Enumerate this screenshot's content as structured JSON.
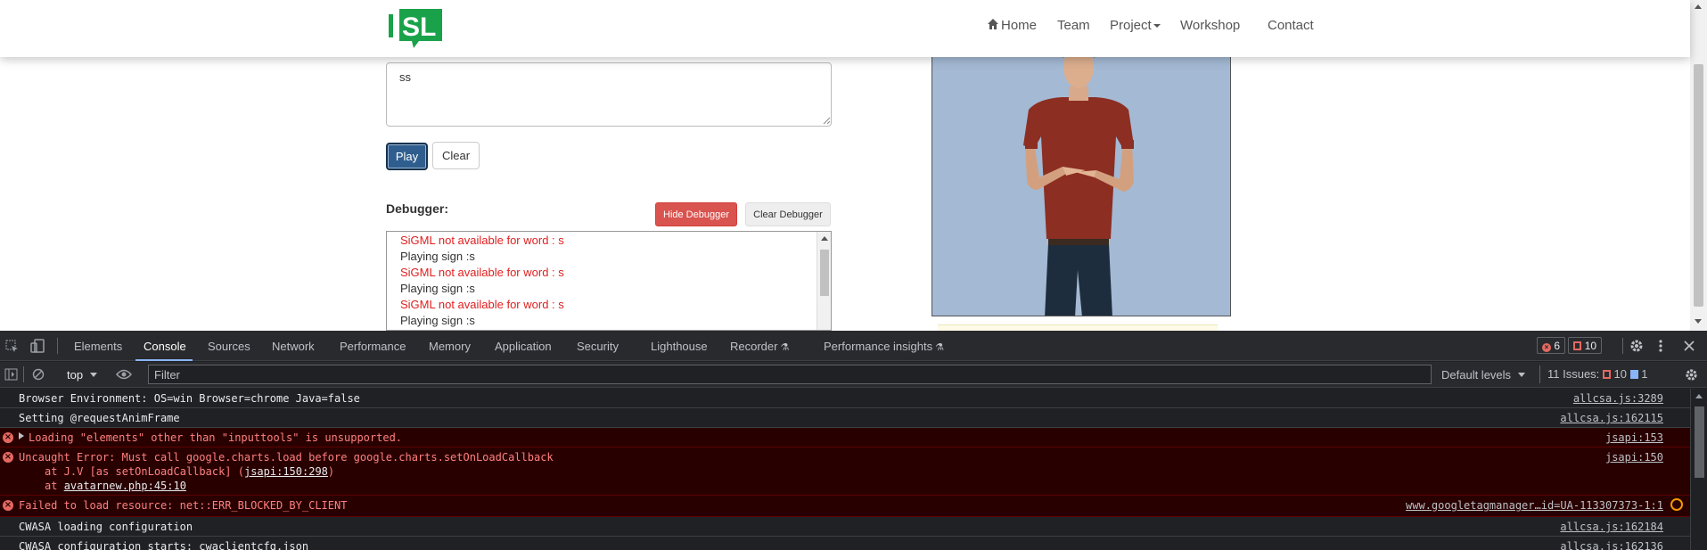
{
  "navbar": {
    "logo_text": "ISL",
    "links": [
      "Home",
      "Team",
      "Project",
      "Workshop",
      "Contact"
    ]
  },
  "translator": {
    "input_value": "ss",
    "play_label": "Play",
    "clear_label": "Clear",
    "debugger_label": "Debugger:",
    "hide_debugger_label": "Hide Debugger",
    "clear_debugger_label": "Clear Debugger",
    "log": [
      {
        "type": "error",
        "text": "SiGML not available for word : s"
      },
      {
        "type": "info",
        "text": "Playing sign :s"
      },
      {
        "type": "error",
        "text": "SiGML not available for word : s"
      },
      {
        "type": "info",
        "text": "Playing sign :s"
      },
      {
        "type": "error",
        "text": "SiGML not available for word : s"
      },
      {
        "type": "info",
        "text": "Playing sign :s"
      }
    ]
  },
  "devtools": {
    "tabs": [
      "Elements",
      "Console",
      "Sources",
      "Network",
      "Performance",
      "Memory",
      "Application",
      "Security",
      "Lighthouse",
      "Recorder",
      "Performance insights"
    ],
    "active_tab": "Console",
    "error_count": "6",
    "issue_flag_count": "10",
    "context": "top",
    "filter_placeholder": "Filter",
    "levels": "Default levels",
    "issues_label": "11 Issues:",
    "issues_error_count": "10",
    "issues_info_count": "1",
    "colors": {
      "error": "#e46962",
      "accent": "#8ab4f8",
      "error_bg": "#290000"
    },
    "messages": [
      {
        "type": "log",
        "text": "Browser Environment:  OS=win  Browser=chrome  Java=false",
        "source": "allcsa.js:3289"
      },
      {
        "type": "log",
        "text": "Setting @requestAnimFrame",
        "source": "allcsa.js:162115"
      },
      {
        "type": "error",
        "text": "Loading \"elements\" other than \"inputtools\" is unsupported.",
        "source": "jsapi:153"
      },
      {
        "type": "error",
        "text": "Uncaught Error: Must call google.charts.load before google.charts.setOnLoadCallback",
        "source": "jsapi:150",
        "stack1_prefix": "at J.V [as setOnLoadCallback] (",
        "stack1_link": "jsapi:150:298",
        "stack1_suffix": ")",
        "stack2_prefix": "at ",
        "stack2_link": "avatarnew.php:45:10"
      },
      {
        "type": "error",
        "text": "Failed to load resource: net::ERR_BLOCKED_BY_CLIENT",
        "source": "www.googletagmanager…id=UA-113307373-1:1"
      },
      {
        "type": "log",
        "text": "CWASA loading configuration",
        "source": "allcsa.js:162184"
      },
      {
        "type": "log",
        "text": "CWASA configuration starts: cwaclientcfg.json",
        "source": "allcsa.js:162136"
      }
    ]
  }
}
